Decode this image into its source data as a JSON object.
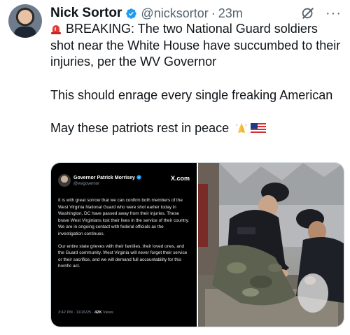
{
  "tweet": {
    "author_name": "Nick Sortor",
    "handle": "@nicksortor",
    "separator": "·",
    "time": "23m",
    "icons": {
      "verified": "verified-badge-icon",
      "grok": "grok-icon",
      "more": "more-icon",
      "siren": "siren-emoji",
      "prayer": "praying-hands-emoji",
      "flag": "us-flag-emoji"
    },
    "line1": "BREAKING: The two National Guard soldiers shot near the White House have succumbed to their injuries, per the WV Governor",
    "line2": "This should enrage every single freaking American",
    "line3": "May these patriots rest in peace",
    "more_glyph": "···"
  },
  "embedded_post": {
    "author_name": "Governor Patrick Morrisey",
    "handle": "@wvgovernor",
    "brand": "X.com",
    "paragraph1": "It is with great sorrow that we can confirm both members of the West Virginia National Guard who were shot earlier today in Washington, DC have passed away from their injuries. These brave West Virginians lost their lives in the service of their country. We are in ongoing contact with federal officials as the investigation continues.",
    "paragraph2": "Our entire state grieves with their families, their loved ones, and the Guard community. West Virginia will never forget their service or their sacrifice, and we will demand full accountability for this horrific act.",
    "timestamp": "3:42 PM · 11/26/25 ·",
    "views_count": "42K",
    "views_label": "Views"
  },
  "colors": {
    "accent_blue": "#1d9bf0",
    "muted_text": "#536471",
    "main_text": "#0f1419"
  }
}
